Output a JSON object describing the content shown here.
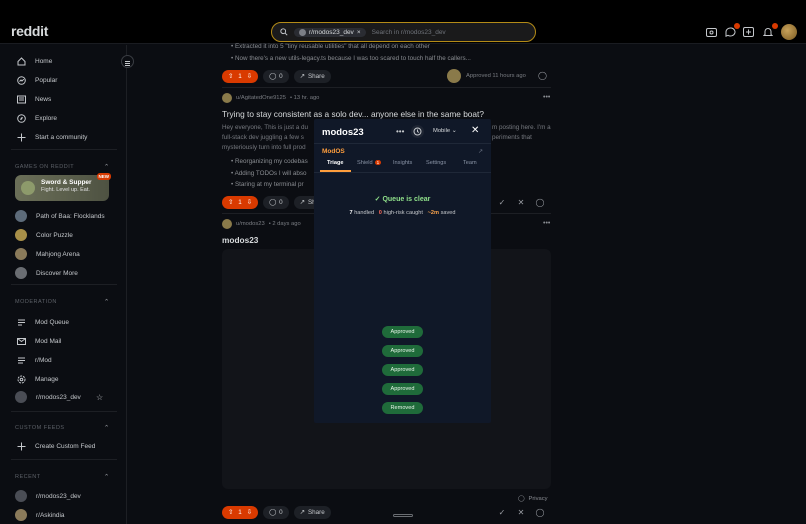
{
  "header": {
    "logo": "reddit",
    "search_chip": "r/modos23_dev",
    "search_chip_close": "×",
    "search_placeholder": "Search in r/modos23_dev",
    "icons": [
      "advertise-icon",
      "chat-icon",
      "create-icon",
      "notifications-icon"
    ],
    "chat_badge": "1",
    "notif_badge": "1"
  },
  "sidebar": {
    "nav": [
      {
        "icon": "home-icon",
        "label": "Home"
      },
      {
        "icon": "popular-icon",
        "label": "Popular"
      },
      {
        "icon": "news-icon",
        "label": "News"
      },
      {
        "icon": "explore-icon",
        "label": "Explore"
      },
      {
        "icon": "plus-icon",
        "label": "Start a community"
      }
    ],
    "games_header": "GAMES ON REDDIT",
    "featured_game": {
      "title": "Sword & Supper",
      "subtitle": "Fight. Level up. Eat.",
      "badge": "NEW"
    },
    "games": [
      "Path of Baa: Flocklands",
      "Color Puzzle",
      "Mahjong Arena",
      "Discover More"
    ],
    "moderation_header": "MODERATION",
    "moderation": [
      "Mod Queue",
      "Mod Mail",
      "r/Mod",
      "Manage",
      "r/modos23_dev"
    ],
    "custom_feeds_header": "CUSTOM FEEDS",
    "custom_feeds": [
      "Create Custom Feed"
    ],
    "recent_header": "RECENT",
    "recent": [
      "r/modos23_dev",
      "r/Askindia"
    ]
  },
  "feed": {
    "post1": {
      "bullets": [
        "Extracted it into 5 \"tiny reusable utilities\" that all depend on each other",
        "Now there's a new utils-legacy.ts because I was too scared to touch half the callers..."
      ],
      "votes": "1",
      "comments": "0",
      "share": "Share",
      "approved_text": "Approved 11 hours ago"
    },
    "post2": {
      "author": "u/AgitatedOne9125",
      "time": "• 13 hr. ago",
      "title": "Trying to stay consistent as a solo dev... anyone else in the same boat?",
      "body1_left": "Hey everyone, This is just a du",
      "body1_right": "m posting here. I'm a",
      "body2_left": "full-stack dev juggling a few s",
      "body2_right": "periments that",
      "body3_left": "mysteriously turn into full prod",
      "bullets": [
        "Reorganizing my codebas",
        "Adding TODOs I will abso",
        "Staring at my terminal pr"
      ],
      "votes": "1",
      "comments": "0",
      "share": "Sh"
    },
    "post3": {
      "author": "u/modos23",
      "time": "• 2 days ago",
      "title": "modos23",
      "votes": "1",
      "comments": "0",
      "share": "Share"
    },
    "privacy": "Privacy"
  },
  "modal": {
    "title": "modos23",
    "mode": "Mobile",
    "brand": "ModOS",
    "tabs": [
      "Triage",
      "Shield",
      "Insights",
      "Settings",
      "Team"
    ],
    "shield_badge": "1",
    "queue_status": "✓ Queue is clear",
    "stats": {
      "handled": "7",
      "handled_label": "handled",
      "risk": "0",
      "risk_label": "high-risk caught",
      "saved": "~2m",
      "saved_label": "saved"
    },
    "history": [
      "Approved",
      "Approved",
      "Approved",
      "Approved",
      "Removed"
    ]
  }
}
